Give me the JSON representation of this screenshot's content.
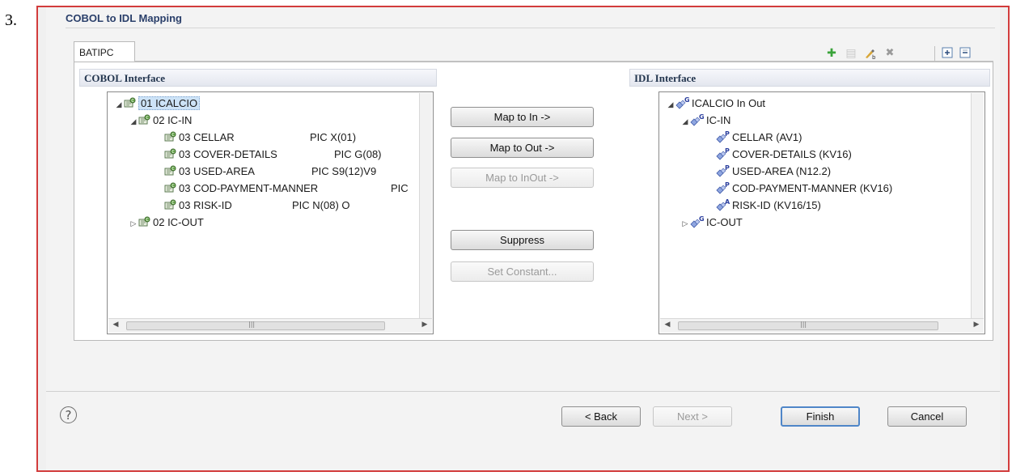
{
  "step_number": "3.",
  "dialog": {
    "section_title": "COBOL to IDL Mapping",
    "tab_label": "BATIPC",
    "toolbar_icons": [
      "add-icon",
      "copy-icon",
      "rename-icon",
      "delete-icon",
      "expand-all-icon",
      "collapse-all-icon"
    ]
  },
  "cobol_pane": {
    "title": "COBOL Interface",
    "rows": [
      {
        "label": "01 ICALCIO",
        "pic": ""
      },
      {
        "label": "02 IC-IN",
        "pic": ""
      },
      {
        "label": "03 CELLAR",
        "pic": "PIC  X(01)"
      },
      {
        "label": "03 COVER-DETAILS",
        "pic": "PIC  G(08)"
      },
      {
        "label": "03 USED-AREA",
        "pic": "PIC  S9(12)V9"
      },
      {
        "label": "03 COD-PAYMENT-MANNER",
        "pic": "PIC"
      },
      {
        "label": "03 RISK-ID",
        "pic": "PIC  N(08)       O"
      },
      {
        "label": "02 IC-OUT",
        "pic": ""
      }
    ]
  },
  "idl_pane": {
    "title": "IDL Interface",
    "rows": [
      {
        "badge": "G",
        "label": "ICALCIO  In Out"
      },
      {
        "badge": "G",
        "label": "IC-IN"
      },
      {
        "badge": "P",
        "label": "CELLAR  (AV1)"
      },
      {
        "badge": "P",
        "label": "COVER-DETAILS  (KV16)"
      },
      {
        "badge": "P",
        "label": "USED-AREA  (N12.2)"
      },
      {
        "badge": "P",
        "label": "COD-PAYMENT-MANNER  (KV16)"
      },
      {
        "badge": "A",
        "label": "RISK-ID  (KV16/15)"
      },
      {
        "badge": "G",
        "label": "IC-OUT"
      }
    ]
  },
  "mapping_buttons": {
    "map_in": "Map to In ->",
    "map_out": "Map to Out ->",
    "map_inout": "Map to InOut ->",
    "suppress": "Suppress",
    "set_constant": "Set Constant..."
  },
  "footer": {
    "back": "< Back",
    "next": "Next >",
    "finish": "Finish",
    "cancel": "Cancel"
  },
  "colors": {
    "window_border": "#d23c3c",
    "section_title": "#2a3f6a",
    "selection": "#cde3f7",
    "default_button_border": "#4f86c8"
  }
}
